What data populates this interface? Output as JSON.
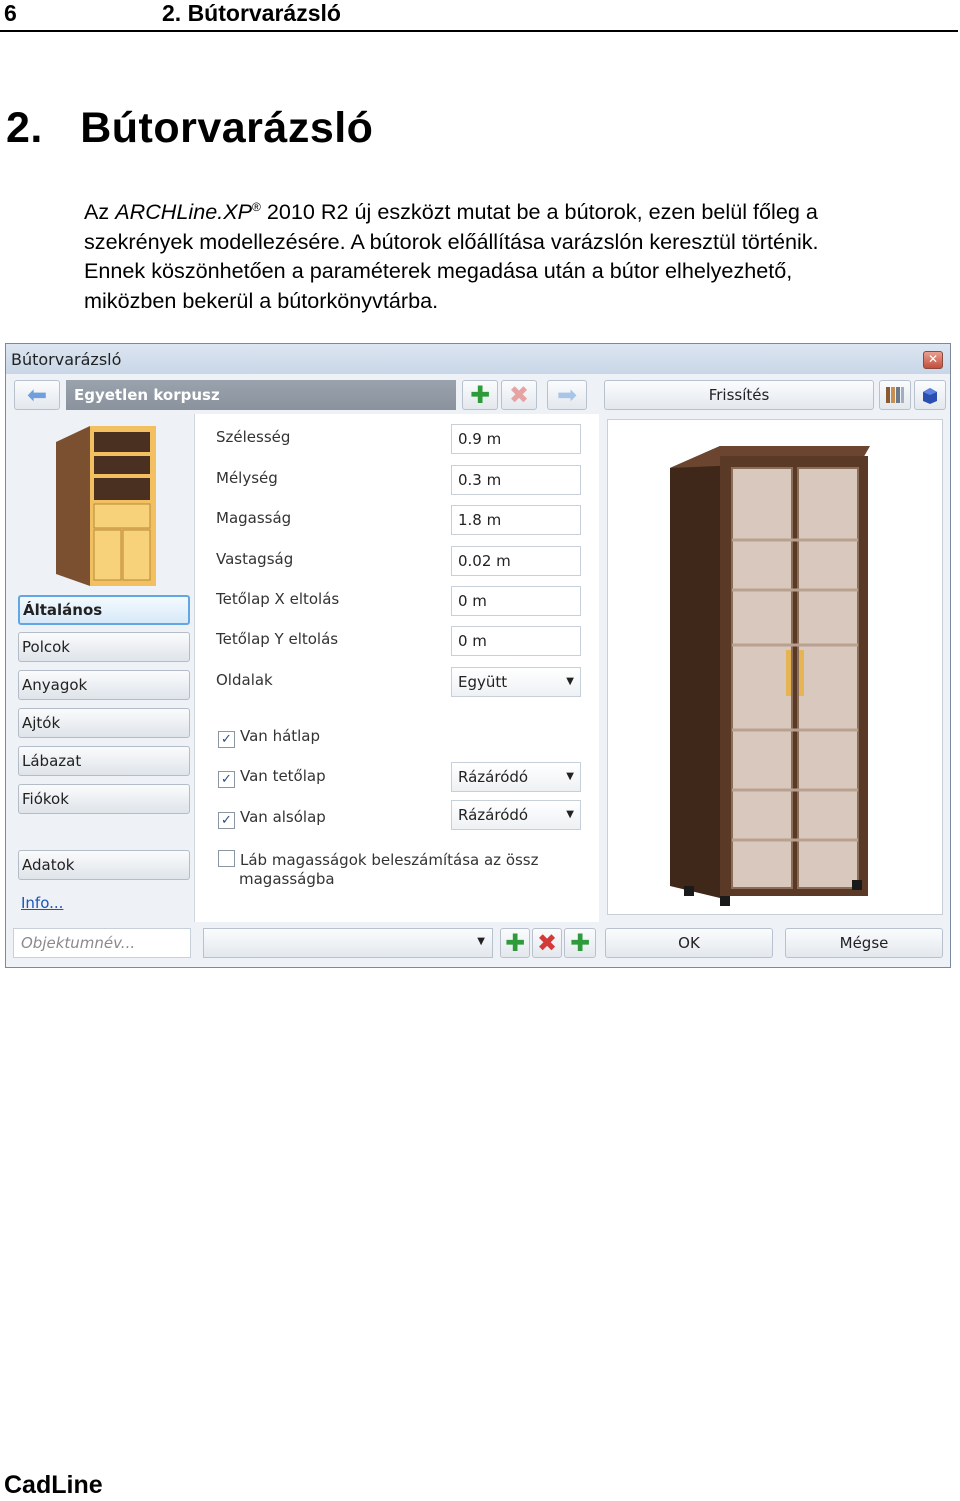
{
  "page": {
    "number": "6",
    "running_head": "2. Bútorvarázsló",
    "chapter_title": "2.   Bútorvarázsló",
    "paragraph": {
      "line1_a": "Az ",
      "line1_brand": "ARCHLine.XP",
      "line1_reg": "®",
      "line1_b": " 2010 R2 új eszközt mutat be a bútorok, ezen belül főleg a",
      "line2": "szekrények modellezésére. A bútorok előállítása varázslón keresztül történik.",
      "line3": "Ennek köszönhetően a paraméterek megadása után a bútor elhelyezhető,",
      "line4": "miközben bekerül a bútorkönyvtárba."
    },
    "footer": "CadLine"
  },
  "dialog": {
    "title": "Bútorvarázsló",
    "close_symbol": "✕",
    "object_name": "Egyetlen korpusz",
    "refresh_label": "Frissítés",
    "toolbar_icons": [
      "arrow-left-icon",
      "plus-icon",
      "delete-icon",
      "arrow-right-icon",
      "library-icon",
      "3d-view-icon"
    ],
    "side_buttons": [
      {
        "label": "Általános",
        "active": true
      },
      {
        "label": "Polcok",
        "active": false
      },
      {
        "label": "Anyagok",
        "active": false
      },
      {
        "label": "Ajtók",
        "active": false
      },
      {
        "label": "Lábazat",
        "active": false
      },
      {
        "label": "Fiókok",
        "active": false
      },
      {
        "label": "Adatok",
        "active": false
      }
    ],
    "info_link": "Info...",
    "fields": [
      {
        "label": "Szélesség",
        "value": "0.9 m"
      },
      {
        "label": "Mélység",
        "value": "0.3 m"
      },
      {
        "label": "Magasság",
        "value": "1.8 m"
      },
      {
        "label": "Vastagság",
        "value": "0.02 m"
      },
      {
        "label": "Tetőlap X eltolás",
        "value": "0 m"
      },
      {
        "label": "Tetőlap Y eltolás",
        "value": "0 m"
      },
      {
        "label": "Oldalak",
        "value": "Együtt"
      }
    ],
    "checkboxes": [
      {
        "label": "Van hátlap",
        "checked": true
      },
      {
        "label": "Van tetőlap",
        "checked": true,
        "select": "Rázáródó"
      },
      {
        "label": "Van alsólap",
        "checked": true,
        "select": "Rázáródó"
      },
      {
        "label": "Láb magasságok beleszámítása az össz",
        "label2": "magasságba",
        "checked": false
      }
    ],
    "object_name_placeholder": "Objektumnév...",
    "ok_label": "OK",
    "cancel_label": "Mégse",
    "colors": {
      "accent": "#62a7e4",
      "cabinet_wood": "#5a3a26",
      "preview_wood": "#e6b455"
    }
  }
}
